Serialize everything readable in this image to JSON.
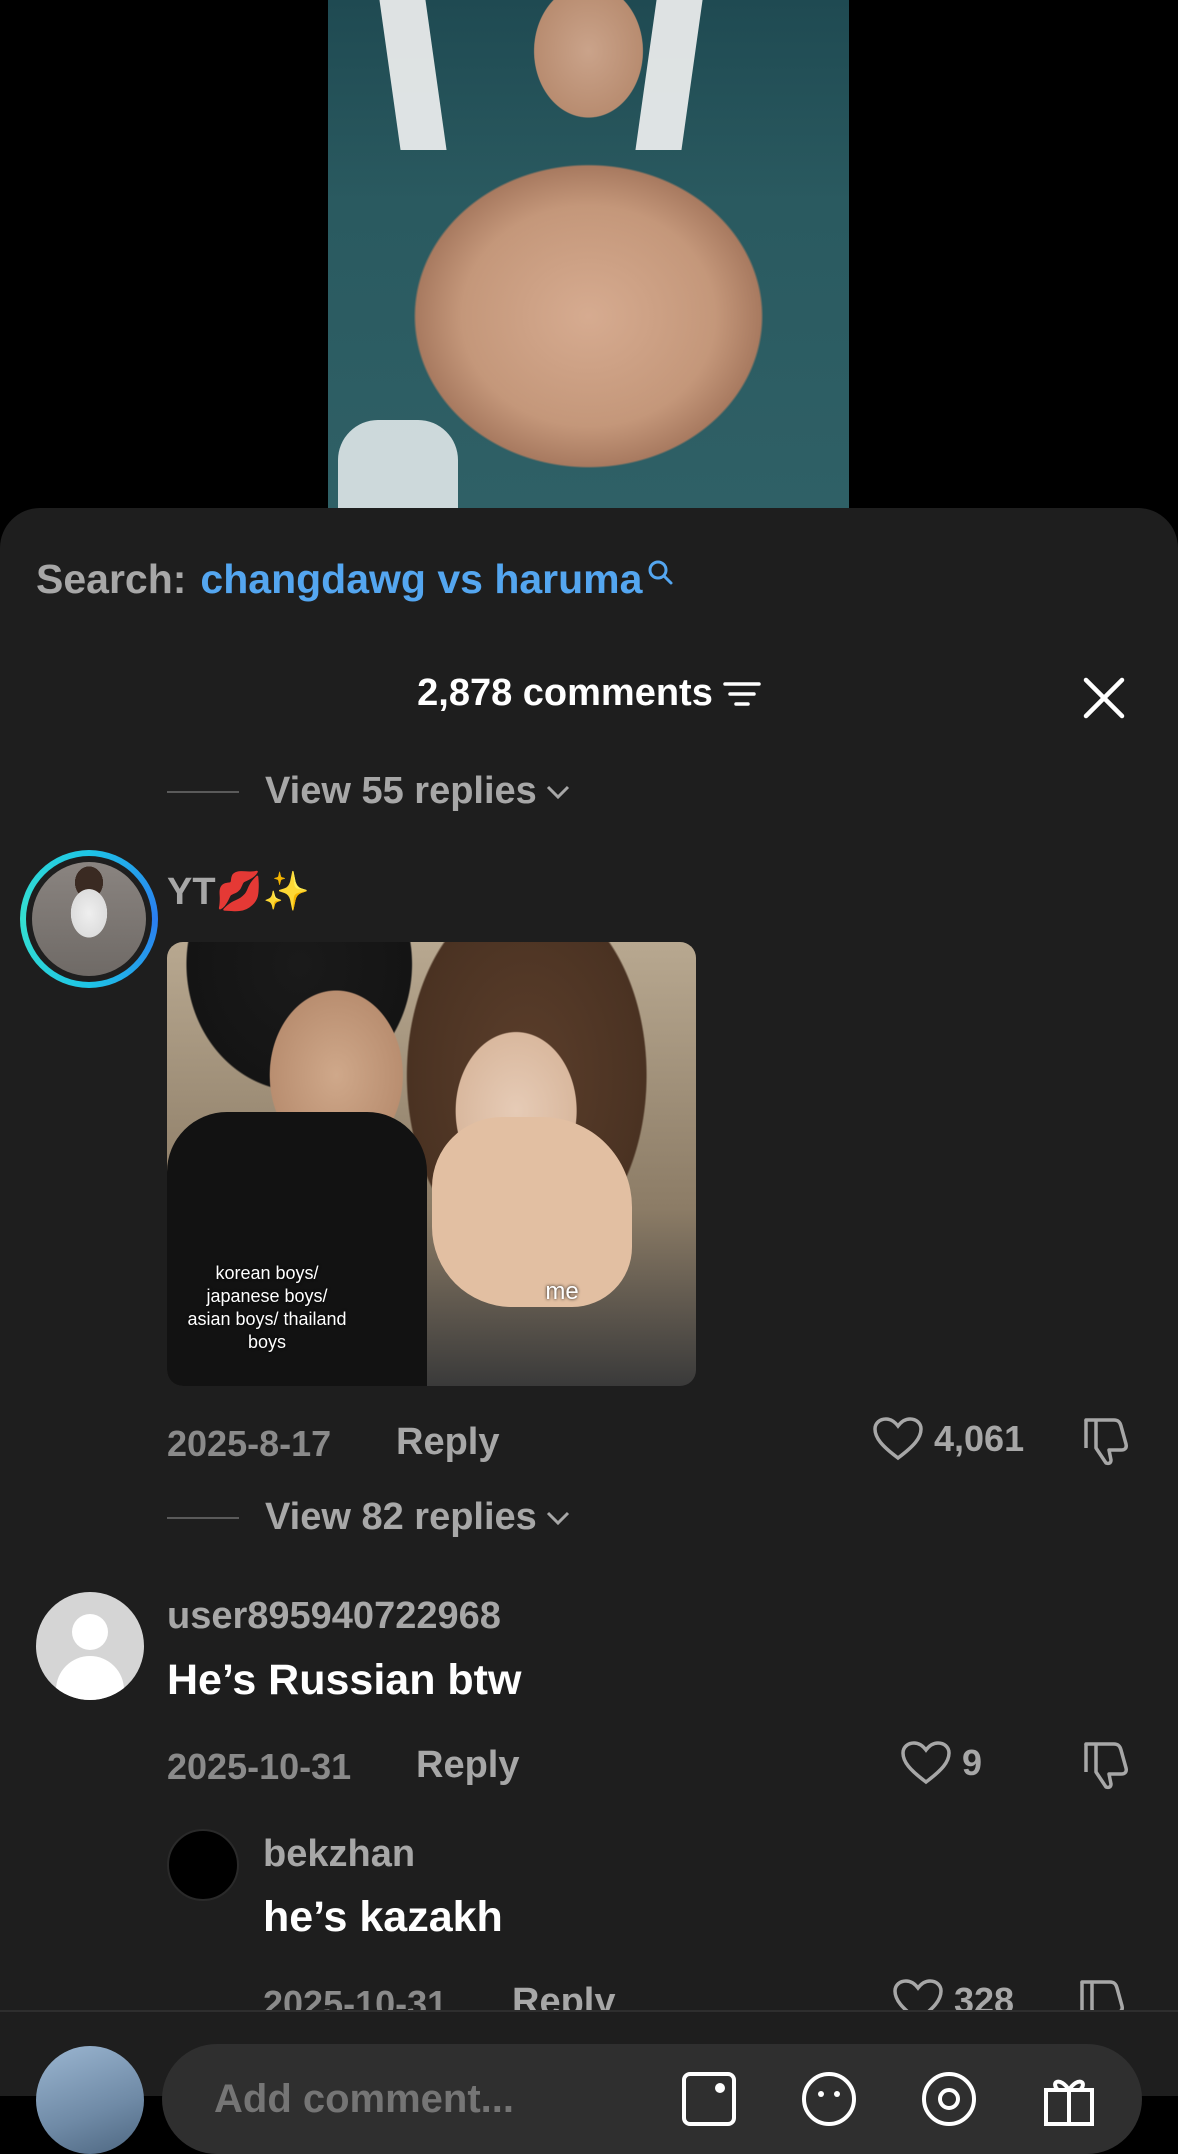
{
  "search": {
    "label": "Search:",
    "term": "changdawg vs haruma"
  },
  "header": {
    "comments_count": "2,878 comments"
  },
  "view_replies_top": "View 55 replies",
  "comment1": {
    "username": "YT💋✨",
    "gif_caption_left": "korean boys/ japanese boys/ asian boys/ thailand boys",
    "gif_caption_right": "me",
    "date": "2025-8-17",
    "reply_label": "Reply",
    "likes": "4,061",
    "view_replies": "View 82 replies"
  },
  "comment2": {
    "username": "user895940722968",
    "text": "He’s Russian btw",
    "date": "2025-10-31",
    "reply_label": "Reply",
    "likes": "9"
  },
  "reply1": {
    "username": "bekzhan",
    "text": "he’s kazakh",
    "date": "2025-10-31",
    "reply_label": "Reply",
    "likes": "328"
  },
  "composer": {
    "placeholder": "Add comment..."
  },
  "colors": {
    "sheet_bg": "#1e1e1e",
    "accent_blue": "#54a6f0",
    "muted": "#a7a7a7"
  }
}
